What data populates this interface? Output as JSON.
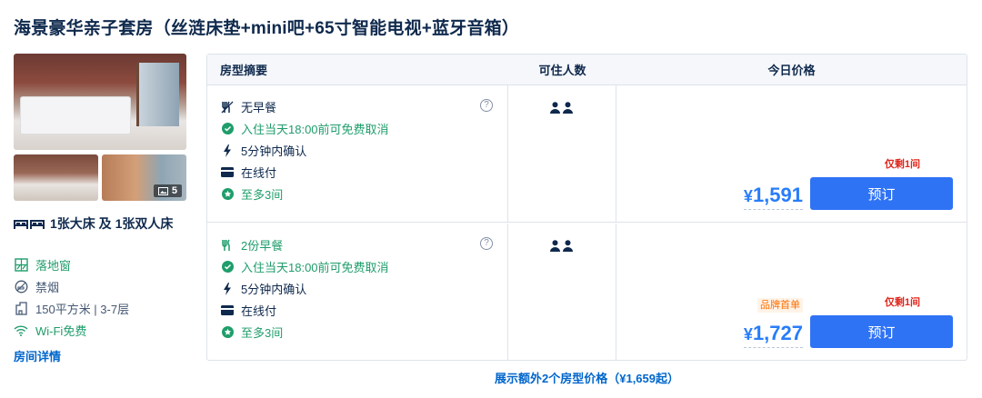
{
  "room": {
    "title": "海景豪华亲子套房（丝涟床垫+mini吧+65寸智能电视+蓝牙音箱）",
    "photo_count": "5",
    "bed": "1张大床 及 1张双人床",
    "features": [
      {
        "icon": "window-icon",
        "label": "落地窗",
        "color": "#1f9d6b"
      },
      {
        "icon": "no-smoking-icon",
        "label": "禁烟",
        "color": "#455873"
      },
      {
        "icon": "room-size-icon",
        "label": "150平方米 | 3-7层",
        "color": "#455873"
      },
      {
        "icon": "wifi-icon",
        "label": "Wi-Fi免费",
        "color": "#1f9d6b"
      }
    ],
    "detail_link": "房间详情"
  },
  "table": {
    "headers": [
      "房型摘要",
      "可住人数",
      "今日价格"
    ],
    "rows": [
      {
        "meal": "无早餐",
        "cancel": "入住当天18:00前可免费取消",
        "confirm": "5分钟内确认",
        "pay": "在线付",
        "max": "至多3间",
        "price_currency": "¥",
        "price_value": "1,591",
        "left": "仅剩1间",
        "brand_tag": "",
        "book": "预订"
      },
      {
        "meal": "2份早餐",
        "cancel": "入住当天18:00前可免费取消",
        "confirm": "5分钟内确认",
        "pay": "在线付",
        "max": "至多3间",
        "price_currency": "¥",
        "price_value": "1,727",
        "left": "仅剩1间",
        "brand_tag": "品牌首单",
        "book": "预订"
      }
    ]
  },
  "more_link": "展示额外2个房型价格（¥1,659起）",
  "colors": {
    "accent": "#2f73f5",
    "price": "#287dfa",
    "green": "#1f9d6b",
    "alert": "#e0251b"
  }
}
